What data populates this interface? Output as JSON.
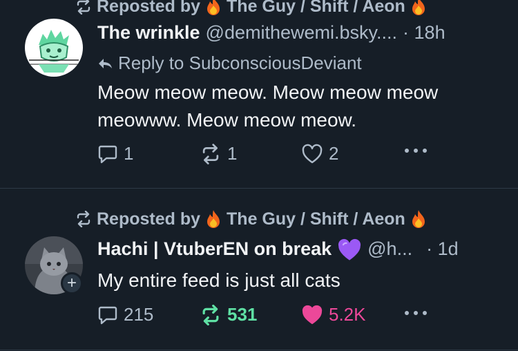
{
  "posts": [
    {
      "repost": {
        "label": "Reposted by",
        "reposter": "The Guy / Shift / Aeon"
      },
      "author": {
        "name": "The wrinkle",
        "handle": "@demithewemi.bsky....",
        "time": "· 18h"
      },
      "reply_to": "Reply to SubconsciousDeviant",
      "text": "Meow meow meow. Meow meow meow meowww. Meow meow meow.",
      "stats": {
        "replies": "1",
        "reposts": "1",
        "likes": "2"
      },
      "reposted_by_me": false,
      "liked_by_me": false
    },
    {
      "repost": {
        "label": "Reposted by",
        "reposter": "The Guy / Shift / Aeon"
      },
      "author": {
        "name": "Hachi | VtuberEN on break",
        "handle": "@h...",
        "time": "· 1d"
      },
      "text": "My entire feed is just all cats",
      "stats": {
        "replies": "215",
        "reposts": "531",
        "likes": "5.2K"
      },
      "reposted_by_me": true,
      "liked_by_me": true,
      "follow_badge": "+"
    }
  ],
  "colors": {
    "background": "#161e27",
    "muted_text": "#aebbc9",
    "repost_active": "#5fe0a4",
    "like_active": "#ec4899",
    "name_emoji": "#9b59f5"
  },
  "icons": [
    "repost-icon",
    "flame-icon",
    "reply-arrow-icon",
    "comment-icon",
    "heart-icon",
    "more-icon",
    "purple-heart-icon"
  ]
}
